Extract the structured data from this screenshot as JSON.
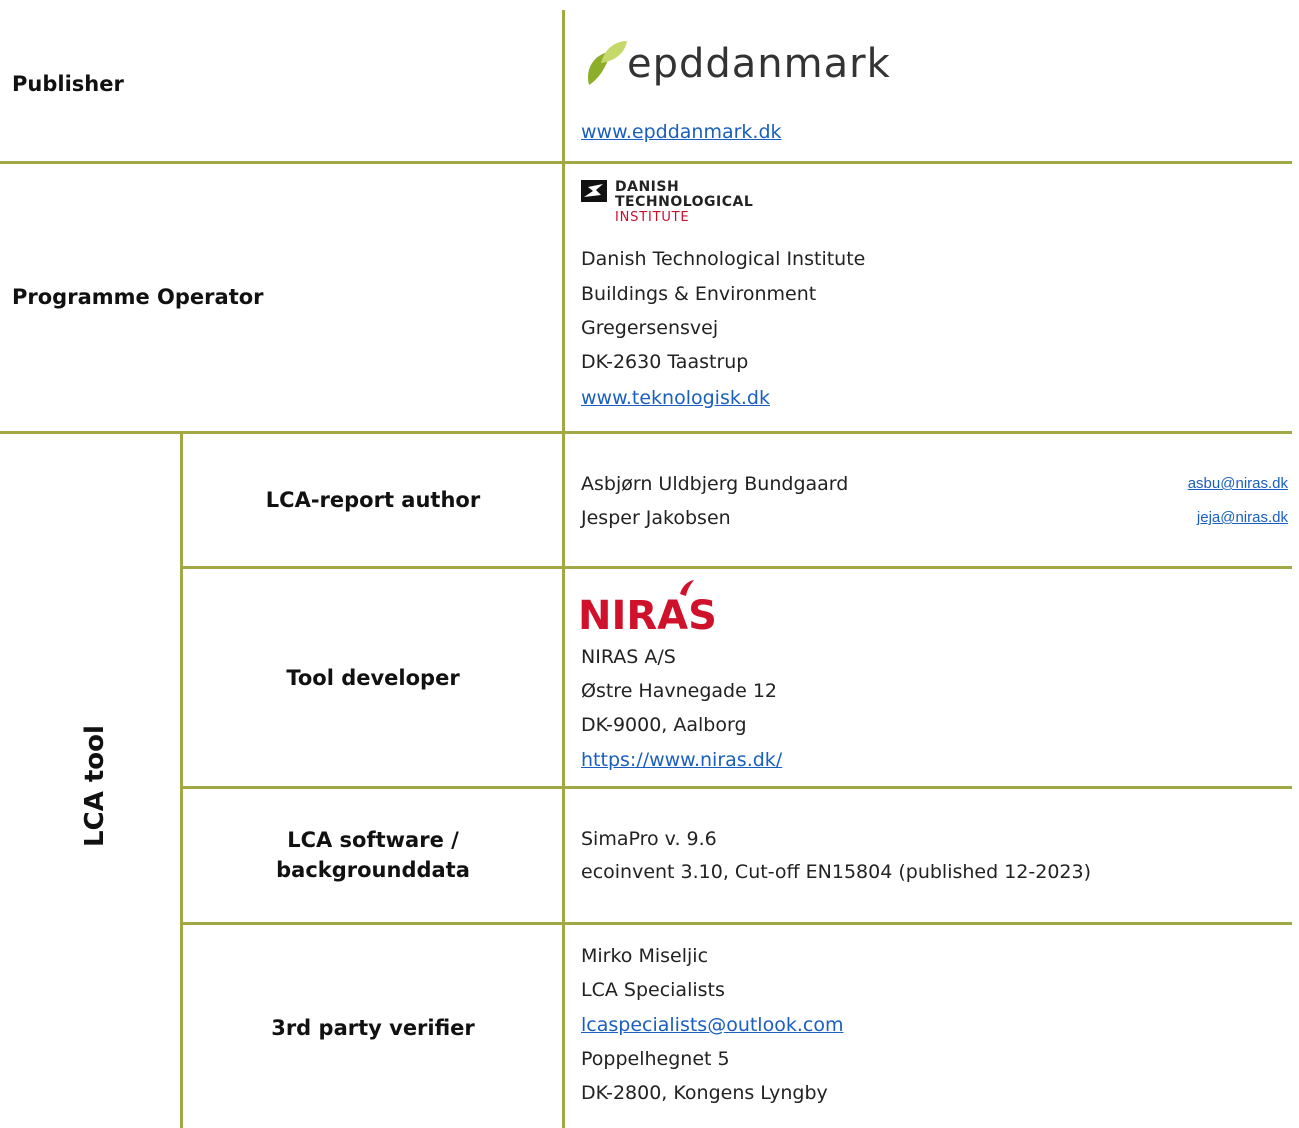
{
  "publisher": {
    "label": "Publisher",
    "logo_text": "epddanmark",
    "url": "www.epddanmark.dk"
  },
  "programme_operator": {
    "label": "Programme Operator",
    "logo_lines": [
      "DANISH",
      "TECHNOLOGICAL",
      "INSTITUTE"
    ],
    "lines": [
      "Danish Technological Institute",
      "Buildings & Environment",
      "Gregersensvej",
      "DK-2630 Taastrup"
    ],
    "url": "www.teknologisk.dk"
  },
  "lca_tool": {
    "group_label": "LCA tool",
    "report_author": {
      "label": "LCA-report author",
      "people": [
        {
          "name": "Asbjørn Uldbjerg Bundgaard",
          "email": "asbu@niras.dk"
        },
        {
          "name": "Jesper Jakobsen",
          "email": "jeja@niras.dk"
        }
      ]
    },
    "tool_developer": {
      "label": "Tool developer",
      "logo_text": "NIRAS",
      "lines": [
        "NIRAS A/S",
        "Østre Havnegade 12",
        "DK-9000, Aalborg"
      ],
      "url": "https://www.niras.dk/"
    },
    "software": {
      "label_line1": "LCA software /",
      "label_line2": "backgrounddata",
      "lines": [
        "SimaPro v. 9.6",
        "ecoinvent 3.10, Cut-off EN15804 (published 12-2023)"
      ]
    },
    "verifier": {
      "label": "3rd party verifier",
      "name": "Mirko Miseljic",
      "company": "LCA Specialists",
      "email": "lcaspecialists@outlook.com",
      "street": "Poppelhegnet 5",
      "city": "DK-2800, Kongens Lyngby"
    }
  },
  "colors": {
    "rule": "#a3a846",
    "link": "#1a5fbf",
    "epd_leaf_dark": "#8dae2a",
    "epd_leaf_light": "#c5d96a",
    "dti_red": "#c8102e",
    "niras_red": "#d0112b"
  }
}
